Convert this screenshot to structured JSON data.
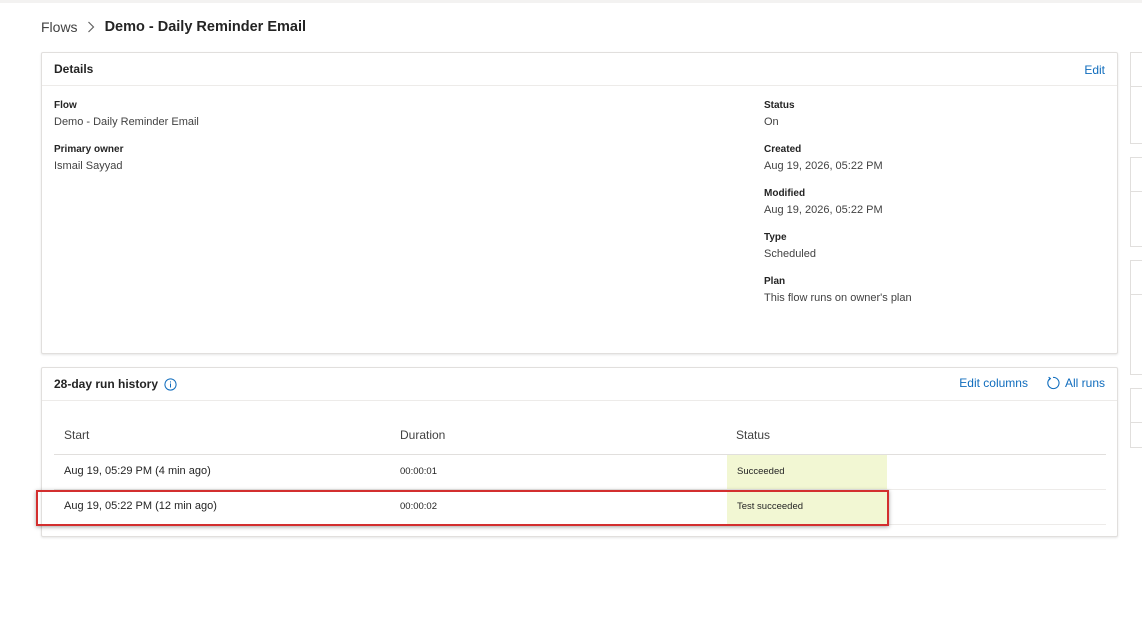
{
  "breadcrumb": {
    "parent": "Flows",
    "current": "Demo - Daily Reminder Email"
  },
  "details": {
    "title": "Details",
    "edit_label": "Edit",
    "flow": {
      "label": "Flow",
      "value": "Demo - Daily Reminder Email"
    },
    "primary_owner": {
      "label": "Primary owner",
      "value": "Ismail Sayyad"
    },
    "status": {
      "label": "Status",
      "value": "On"
    },
    "created": {
      "label": "Created",
      "value": "Aug 19, 2026, 05:22 PM"
    },
    "modified": {
      "label": "Modified",
      "value": "Aug 19, 2026, 05:22 PM"
    },
    "type": {
      "label": "Type",
      "value": "Scheduled"
    },
    "plan": {
      "label": "Plan",
      "value": "This flow runs on owner's plan"
    }
  },
  "run_history": {
    "title": "28-day run history",
    "edit_columns_label": "Edit columns",
    "all_runs_label": "All runs",
    "columns": [
      "Start",
      "Duration",
      "Status"
    ],
    "rows": [
      {
        "start": "Aug 19, 05:29 PM (4 min ago)",
        "duration": "00:00:01",
        "status": "Succeeded"
      },
      {
        "start": "Aug 19, 05:22 PM (12 min ago)",
        "duration": "00:00:02",
        "status": "Test succeeded"
      }
    ]
  },
  "colors": {
    "accent": "#0f6cbd",
    "status_fill": "#f2f7d3",
    "highlight": "#d32f2f"
  },
  "icons": {
    "separator": "chevron-right-icon",
    "info": "info-icon",
    "all_runs": "refresh-icon"
  }
}
